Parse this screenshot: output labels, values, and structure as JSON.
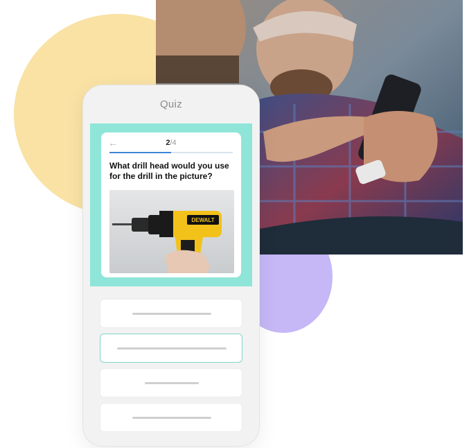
{
  "app": {
    "title": "Quiz"
  },
  "quiz": {
    "back_icon": "arrow-left-icon",
    "current_step": "2",
    "separator": "/",
    "total_steps": "4",
    "progress_fraction": 0.5,
    "question": "What drill head would you use for the drill in the picture?",
    "image_brand": "DEWALT",
    "answers": [
      {
        "selected": false
      },
      {
        "selected": true
      },
      {
        "selected": false
      },
      {
        "selected": false
      }
    ]
  },
  "colors": {
    "teal": "#8fe5d8",
    "yellow_blob": "#f9e2a4",
    "purple_blob": "#c6b7f6",
    "progress_blue": "#3d84d6",
    "drill_yellow": "#f2c21b"
  }
}
